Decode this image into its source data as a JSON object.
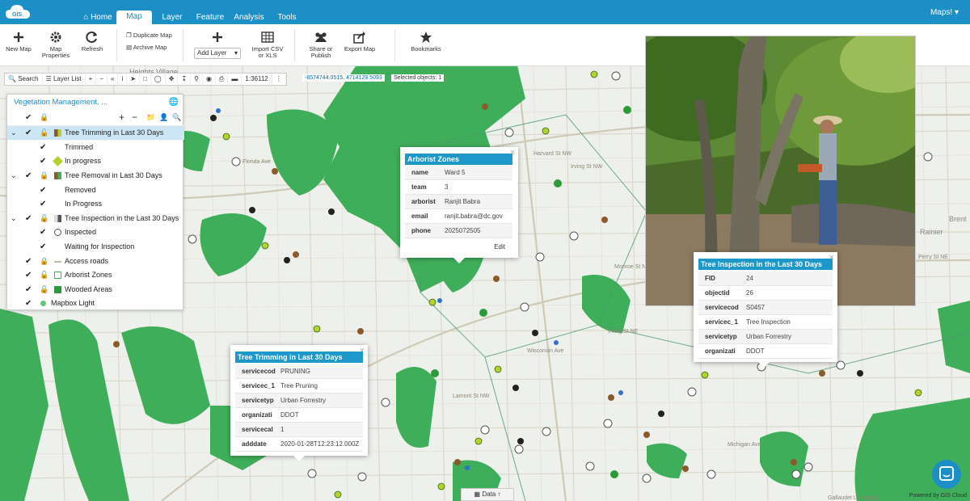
{
  "nav": {
    "brand": "GIS",
    "tabs": [
      "Home",
      "Map",
      "Layer",
      "Feature",
      "Analysis",
      "Tools"
    ],
    "active_tab": "Map",
    "user_menu": "Maps!"
  },
  "ribbon": {
    "new_map": "New Map",
    "map_properties": "Map Properties",
    "refresh": "Refresh",
    "duplicate_map": "Duplicate Map",
    "archive_map": "Archive Map",
    "add_layer": "Add Layer",
    "import_csv": "Import CSV or XLS",
    "share_publish": "Share or Publish",
    "export_map": "Export Map",
    "bookmarks": "Bookmarks"
  },
  "toolbar": {
    "search": "Search",
    "layer_list": "Layer List",
    "scale": "1:36112",
    "coordinates": "-8574744.0515, 4714129.5093",
    "selected": "Selected objects: 1"
  },
  "layer_panel": {
    "title": "Vegetation Management, ...",
    "rows": [
      {
        "label": "Tree Trimming in Last 30 Days",
        "kind": "group",
        "selected": true
      },
      {
        "label": "Trimmed",
        "kind": "item"
      },
      {
        "label": "In progress",
        "kind": "item"
      },
      {
        "label": "Tree Removal in Last 30 Days",
        "kind": "group"
      },
      {
        "label": "Removed",
        "kind": "item"
      },
      {
        "label": "In Progress",
        "kind": "item"
      },
      {
        "label": "Tree Inspection in the Last 30 Days",
        "kind": "group"
      },
      {
        "label": "Inspected",
        "kind": "item"
      },
      {
        "label": "Waiting for Inspection",
        "kind": "item"
      },
      {
        "label": "Access roads",
        "kind": "layer"
      },
      {
        "label": "Arborist Zones",
        "kind": "layer"
      },
      {
        "label": "Wooded Areas",
        "kind": "layer"
      },
      {
        "label": "Mapbox Light",
        "kind": "base"
      }
    ]
  },
  "popups": {
    "arborist": {
      "title": "Arborist Zones",
      "rows": [
        {
          "k": "name",
          "v": "Ward 5"
        },
        {
          "k": "team",
          "v": "3"
        },
        {
          "k": "arborist",
          "v": "Ranjit Babra"
        },
        {
          "k": "email",
          "v": "ranjit.babra@dc.gov"
        },
        {
          "k": "phone",
          "v": "2025072505"
        }
      ],
      "edit": "Edit"
    },
    "trimming": {
      "title": "Tree Trimming in Last 30 Days",
      "rows": [
        {
          "k": "servicecod",
          "v": "PRUNING"
        },
        {
          "k": "servicec_1",
          "v": "Tree Pruning"
        },
        {
          "k": "servicetyp",
          "v": "Urban Forrestry"
        },
        {
          "k": "organizati",
          "v": "DDOT"
        },
        {
          "k": "servicecal",
          "v": "1"
        },
        {
          "k": "adddate",
          "v": "2020-01-28T12:23:12.000Z"
        }
      ]
    },
    "inspection": {
      "title": "Tree Inspection in the Last 30 Days",
      "rows": [
        {
          "k": "FID",
          "v": "24"
        },
        {
          "k": "objectid",
          "v": "26"
        },
        {
          "k": "servicecod",
          "v": "S0457"
        },
        {
          "k": "servicec_1",
          "v": "Tree Inspection"
        },
        {
          "k": "servicetyp",
          "v": "Urban Forrestry"
        },
        {
          "k": "organizati",
          "v": "DDOT"
        }
      ]
    }
  },
  "map_labels": {
    "heights_village": "Heights Village",
    "rainier": "Rainier",
    "brent": "Brent"
  },
  "footer": {
    "data_tab": "Data",
    "powered": "Powered by GIS Cloud"
  },
  "colors": {
    "brand": "#1b8fc6",
    "popup_header": "#1e98c9",
    "wooded": "#3fae5a",
    "land": "#eef0ec",
    "road": "#d9d5c7"
  }
}
